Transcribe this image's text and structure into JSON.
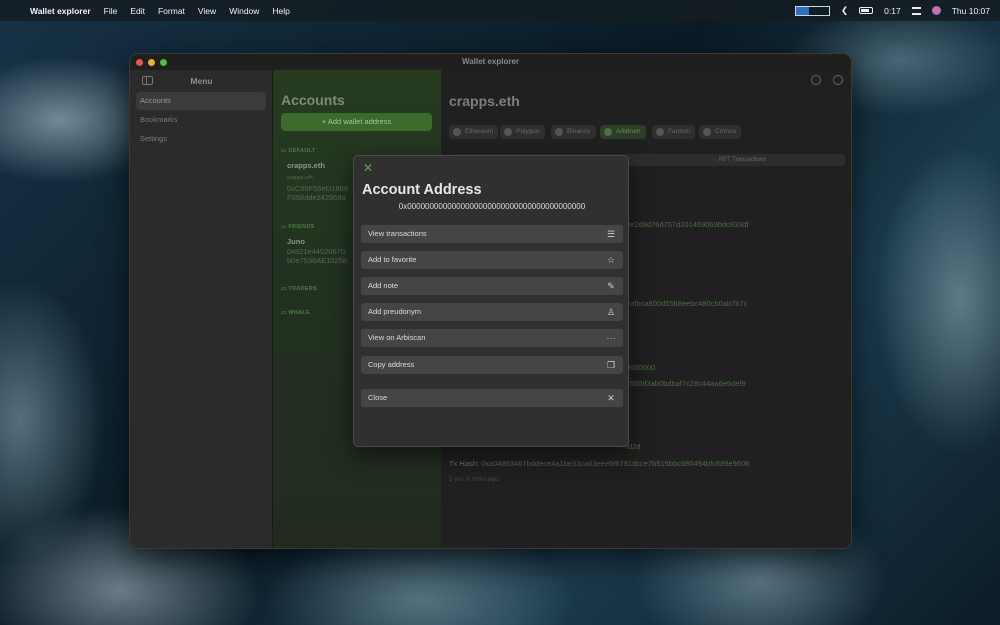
{
  "menubar": {
    "apple": "",
    "app_name": "Wallet explorer",
    "menus": [
      "File",
      "Edit",
      "Format",
      "View",
      "Window",
      "Help"
    ],
    "battery_time": "0:17",
    "clock": "Thu 10:07"
  },
  "window": {
    "title": "Wallet explorer"
  },
  "sidebar": {
    "title": "Menu",
    "items": [
      {
        "label": "Accounts"
      },
      {
        "label": "Bookmarks"
      },
      {
        "label": "Settings"
      }
    ]
  },
  "accounts": {
    "title": "Accounts",
    "add_label": "+ Add wallet address",
    "groups": {
      "default": "DEFAULT",
      "friends": "FRIENDS",
      "traders": "TRADERS",
      "whale": "WHALE"
    },
    "list": [
      {
        "name": "crapps.eth",
        "sub": "crapps.eth",
        "addr_line1": "0xC65F56eD1869",
        "addr_line2": "F058dde242968a"
      },
      {
        "name": "Juno",
        "addr_line1": "0x821e4402067D",
        "addr_line2": "b0e7536AE10258"
      }
    ]
  },
  "detail": {
    "title": "crapps.eth",
    "chains": [
      {
        "label": "Ethereum"
      },
      {
        "label": "Polygon"
      },
      {
        "label": "Binance"
      },
      {
        "label": "Arbitrum"
      },
      {
        "label": "Fantom"
      },
      {
        "label": "Cronos"
      }
    ],
    "nft_tab": "NFT Transactions",
    "visible_fragments": [
      "8e2d8d76d757d201469069bdc833df",
      "2afbca800d55b8eebc480cb0ab7b7c",
      "0000000",
      "c550d3ab0bdbaf7c28c44aa6e5def9",
      "fd2d"
    ],
    "tx_label": "Tx Hash:",
    "tx_hash": "0xa04893467bddece4a1be33ca63eee5f6781dcce7b515bbc980494bfc689e9606",
    "time_ago": "2 yrs, 6 mths ago"
  },
  "modal": {
    "title": "Account Address",
    "address": "0x0000000000000000000000000000000000000000",
    "actions": [
      {
        "label": "View transactions",
        "icon": "list-icon"
      },
      {
        "label": "Add to favorite",
        "icon": "star-icon"
      },
      {
        "label": "Add note",
        "icon": "edit-note-icon"
      },
      {
        "label": "Add preudonym",
        "icon": "person-icon"
      },
      {
        "label": "View on Arbiscan",
        "icon": "ellipsis-icon"
      },
      {
        "label": "Copy address",
        "icon": "copy-icon"
      },
      {
        "label": "Close",
        "icon": "close-icon"
      }
    ]
  },
  "colors": {
    "accent_green": "#5fa24e",
    "modal_bg": "#2f302f",
    "button_bg": "#444544"
  }
}
